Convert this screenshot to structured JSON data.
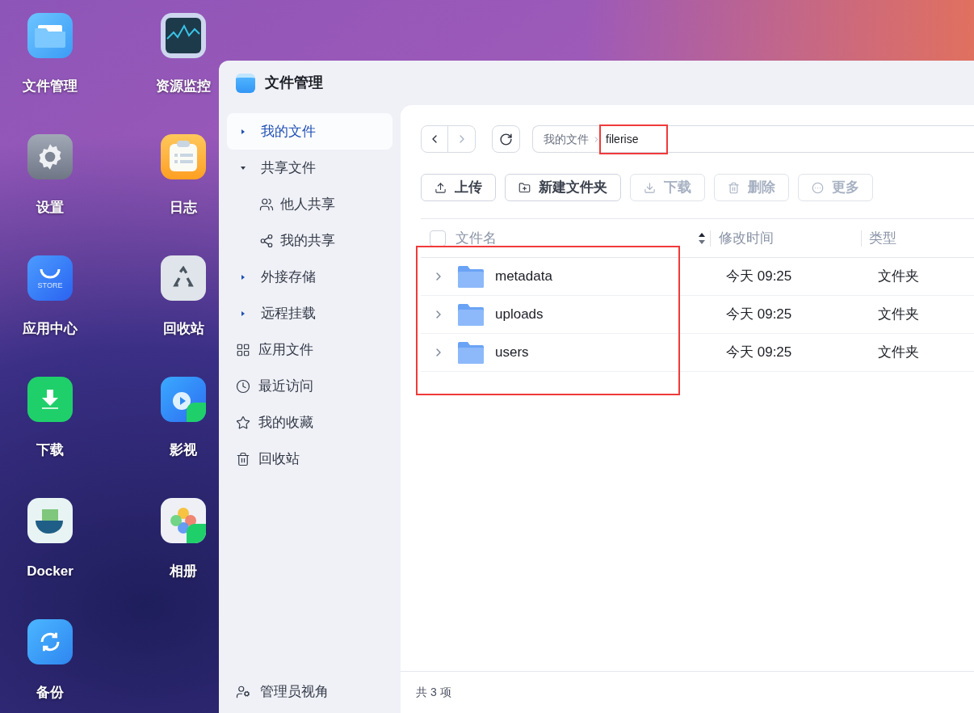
{
  "desktop": {
    "apps": [
      {
        "label": "文件管理"
      },
      {
        "label": "资源监控"
      },
      {
        "label": "设置"
      },
      {
        "label": "日志"
      },
      {
        "label": "应用中心",
        "icon_text": "STORE"
      },
      {
        "label": "回收站"
      },
      {
        "label": "下载"
      },
      {
        "label": "影视"
      },
      {
        "label": "Docker"
      },
      {
        "label": "相册"
      },
      {
        "label": "备份"
      }
    ]
  },
  "window": {
    "title": "文件管理",
    "sidebar": {
      "items": [
        {
          "kind": "tree",
          "label": "我的文件",
          "selected": true,
          "expanded": false
        },
        {
          "kind": "tree",
          "label": "共享文件",
          "selected": false,
          "expanded": true,
          "children": [
            {
              "label": "他人共享",
              "selected": false
            },
            {
              "label": "我的共享",
              "selected": false
            }
          ]
        },
        {
          "kind": "tree",
          "label": "外接存储",
          "selected": false,
          "expanded": false
        },
        {
          "kind": "tree",
          "label": "远程挂载",
          "selected": false,
          "expanded": false
        },
        {
          "kind": "link",
          "label": "应用文件",
          "selected": false
        },
        {
          "kind": "link",
          "label": "最近访问",
          "selected": false
        },
        {
          "kind": "link",
          "label": "我的收藏",
          "selected": false
        },
        {
          "kind": "link",
          "label": "回收站",
          "selected": false
        }
      ],
      "footer": "管理员视角"
    },
    "nav": {
      "back_disabled": false,
      "forward_disabled": true
    },
    "breadcrumb": [
      "我的文件",
      "filerise"
    ],
    "toolbar": [
      {
        "label": "上传",
        "disabled": false
      },
      {
        "label": "新建文件夹",
        "disabled": false
      },
      {
        "label": "下载",
        "disabled": true
      },
      {
        "label": "删除",
        "disabled": true
      },
      {
        "label": "更多",
        "disabled": true
      }
    ],
    "table": {
      "all_checked": false,
      "columns": [
        "文件名",
        "修改时间",
        "类型"
      ],
      "rows": [
        {
          "name": "metadata",
          "modified": "今天 09:25",
          "type": "文件夹"
        },
        {
          "name": "uploads",
          "modified": "今天 09:25",
          "type": "文件夹"
        },
        {
          "name": "users",
          "modified": "今天 09:25",
          "type": "文件夹"
        }
      ]
    },
    "status_bar": "共 3 项"
  }
}
